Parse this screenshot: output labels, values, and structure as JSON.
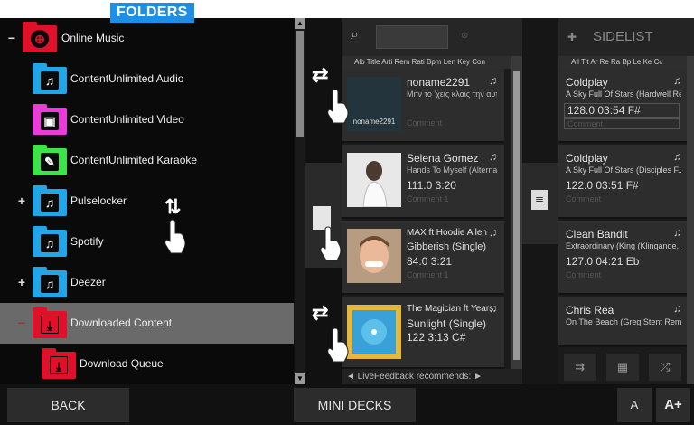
{
  "folders_label": "FOLDERS",
  "tree": [
    {
      "label": "Online Music",
      "expander": "−",
      "color": "#e0102a",
      "glyph": "⊕"
    },
    {
      "label": "ContentUnlimited Audio",
      "expander": "",
      "color": "#22a6e8",
      "glyph": "♫"
    },
    {
      "label": "ContentUnlimited Video",
      "expander": "",
      "color": "#e93cd8",
      "glyph": "▣"
    },
    {
      "label": "ContentUnlimited Karaoke",
      "expander": "",
      "color": "#3ee34a",
      "glyph": "✎"
    },
    {
      "label": "Pulselocker",
      "expander": "+",
      "color": "#22a6e8",
      "glyph": "♫"
    },
    {
      "label": "Spotify",
      "expander": "",
      "color": "#22a6e8",
      "glyph": "♫"
    },
    {
      "label": "Deezer",
      "expander": "+",
      "color": "#22a6e8",
      "glyph": "♫"
    },
    {
      "label": "Downloaded Content",
      "expander": "−",
      "color": "#e0102a",
      "glyph": "⤓"
    },
    {
      "label": "Download Queue",
      "expander": "",
      "color": "#e0102a",
      "glyph": "⤓"
    }
  ],
  "columns_main": "Alb Title Arti Rem Rati Bpm Len Key Con",
  "tracks": [
    {
      "title": "noname2291",
      "sub": "Μην το 'χεις κλαις την αυτό...",
      "info": "",
      "comment": "Comment",
      "cover_text": "noname2291"
    },
    {
      "title": "Selena Gomez",
      "sub": "Hands To Myself (Alterna...",
      "info": "111.0  3:20",
      "comment": "Comment  1",
      "cover_text": ""
    },
    {
      "title": "MAX ft Hoodie Allen",
      "sub": "Gibberish (Single)",
      "info": "84.0   3:21",
      "comment": "Comment  1",
      "cover_text": ""
    },
    {
      "title": "The Magician ft Years...",
      "sub": "Sunlight (Single)",
      "info": "122    3:13  C#",
      "comment": "",
      "cover_text": ""
    }
  ],
  "feedback": "◄ LiveFeedback recommends:  ►",
  "sidelist": {
    "title": "SIDELIST",
    "columns": "All Tit Ar Re Ra Bp Le Ke Cc",
    "tracks": [
      {
        "artist": "Coldplay",
        "title": "A Sky Full Of Stars (Hardwell Remi",
        "info": "128.0  03:54  F#",
        "comment": "Comment"
      },
      {
        "artist": "Coldplay",
        "title": "A Sky Full Of Stars (Disciples F...",
        "info": "122.0  03:51  F#",
        "comment": "Comment"
      },
      {
        "artist": "Clean Bandit",
        "title": "Extraordinary (King (Klingande...",
        "info": "127.0  04:21  Eb",
        "comment": "Comment"
      },
      {
        "artist": "Chris Rea",
        "title": "On The Beach (Greg Stent Rem...",
        "info": "",
        "comment": ""
      }
    ]
  },
  "buttons": {
    "back": "BACK",
    "mini_decks": "MINI DECKS",
    "font_small": "A",
    "font_large": "A+"
  },
  "colors": {
    "accent": "#1e8fe6",
    "selected_row": "#6a6a6a"
  }
}
